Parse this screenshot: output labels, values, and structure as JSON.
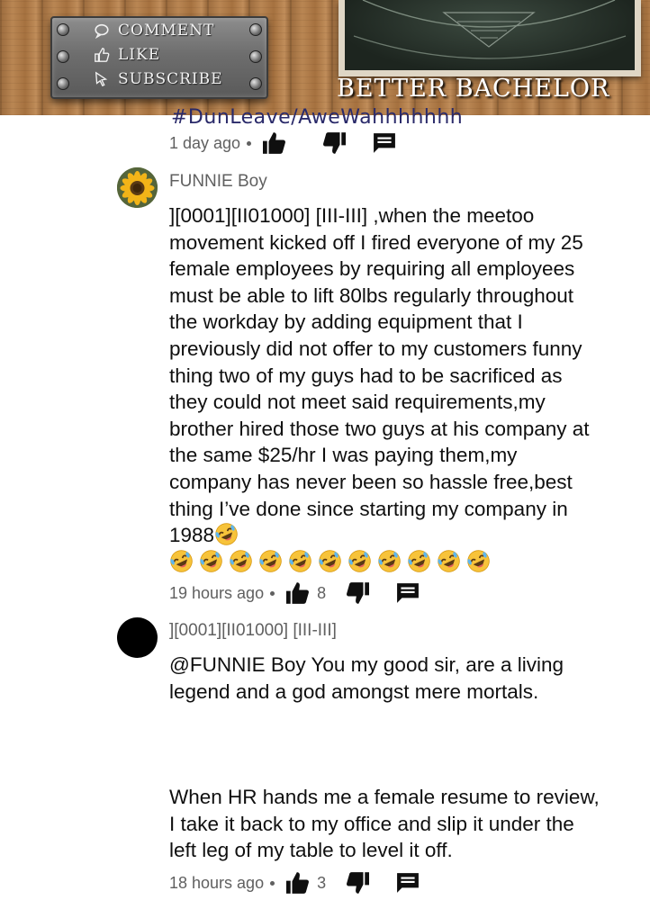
{
  "banner": {
    "sign": {
      "comment": "COMMENT",
      "like": "LIKE",
      "subscribe": "SUBSCRIBE"
    },
    "brand": "BETTER BACHELOR"
  },
  "thread": {
    "cut_text": "#DunLeave/AweWahhhhhhh",
    "top_meta": {
      "time": "1 day ago"
    },
    "comments": [
      {
        "author": "FUNNIE Boy",
        "body": "][0001][II01000] [III-III] ,when the meetoo movement kicked off I fired everyone of my 25 female employees by requiring all employees must be able to lift 80lbs regularly throughout the workday by adding equipment that I previously did not offer to my customers funny thing two of my guys had to be sacrificed as they could not meet said requirements,my brother hired those two guys at his company at the same $25/hr I was paying them,my company has never been so hassle free,best thing I’ve done since starting my company in 1988",
        "time": "19 hours ago",
        "likes": "8",
        "avatar": "sunflower-avatar"
      },
      {
        "author": "][0001][II01000] [III-III]",
        "body": "@FUNNIE Boy You my good sir, are a living legend and a god amongst mere mortals.",
        "body2": "When HR hands me a female resume to review, I take it back to my office and slip it under the left leg of my table to level it off.",
        "time": "18 hours ago",
        "likes": "3",
        "avatar": "black-circle-avatar"
      }
    ]
  },
  "icons": {
    "like": "thumbs-up-icon",
    "dislike": "thumbs-down-icon",
    "reply": "reply-icon",
    "emoji": "rolling-on-floor-laughing"
  },
  "colors": {
    "meta_text": "#606060",
    "body_text": "#0f0f0f",
    "emoji_yellow": "#f7c33a"
  }
}
